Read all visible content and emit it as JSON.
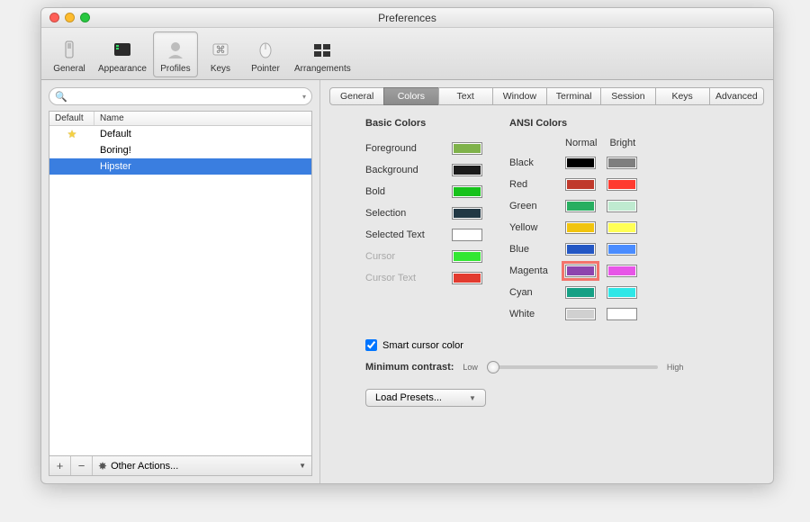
{
  "window": {
    "title": "Preferences"
  },
  "toolbar": {
    "items": [
      {
        "label": "General"
      },
      {
        "label": "Appearance"
      },
      {
        "label": "Profiles"
      },
      {
        "label": "Keys"
      },
      {
        "label": "Pointer"
      },
      {
        "label": "Arrangements"
      }
    ],
    "selected": "Profiles"
  },
  "sidebar": {
    "search_placeholder": "",
    "columns": {
      "default": "Default",
      "name": "Name"
    },
    "profiles": [
      {
        "name": "Default",
        "default": true,
        "selected": false
      },
      {
        "name": "Boring!",
        "default": false,
        "selected": false
      },
      {
        "name": "Hipster",
        "default": false,
        "selected": true
      }
    ],
    "add": "+",
    "remove": "−",
    "other_actions": "Other Actions..."
  },
  "tabs": {
    "items": [
      "General",
      "Colors",
      "Text",
      "Window",
      "Terminal",
      "Session",
      "Keys",
      "Advanced"
    ],
    "selected": "Colors"
  },
  "basic": {
    "heading": "Basic Colors",
    "rows": [
      {
        "label": "Foreground",
        "color": "#7fb24a",
        "dim": false
      },
      {
        "label": "Background",
        "color": "#1b1b1b",
        "dim": false
      },
      {
        "label": "Bold",
        "color": "#17c21b",
        "dim": false
      },
      {
        "label": "Selection",
        "color": "#223844",
        "dim": false
      },
      {
        "label": "Selected Text",
        "color": "#ffffff",
        "dim": false
      },
      {
        "label": "Cursor",
        "color": "#32e732",
        "dim": true
      },
      {
        "label": "Cursor Text",
        "color": "#e23b2f",
        "dim": true
      }
    ]
  },
  "ansi": {
    "heading": "ANSI Colors",
    "head_normal": "Normal",
    "head_bright": "Bright",
    "rows": [
      {
        "label": "Black",
        "normal": "#000000",
        "bright": "#7f7f7f"
      },
      {
        "label": "Red",
        "normal": "#c0392b",
        "bright": "#ff3b30"
      },
      {
        "label": "Green",
        "normal": "#27ae60",
        "bright": "#bfead0"
      },
      {
        "label": "Yellow",
        "normal": "#f1c40f",
        "bright": "#ffff55"
      },
      {
        "label": "Blue",
        "normal": "#2357c4",
        "bright": "#4a8cff"
      },
      {
        "label": "Magenta",
        "normal": "#8e44ad",
        "bright": "#e755e7",
        "highlight": true
      },
      {
        "label": "Cyan",
        "normal": "#16a085",
        "bright": "#2ee7e7"
      },
      {
        "label": "White",
        "normal": "#d0d0d0",
        "bright": "#ffffff"
      }
    ]
  },
  "smart_cursor": {
    "checked": true,
    "label": "Smart cursor color"
  },
  "contrast": {
    "label": "Minimum contrast:",
    "low": "Low",
    "high": "High",
    "value": 0
  },
  "load_presets": "Load Presets..."
}
